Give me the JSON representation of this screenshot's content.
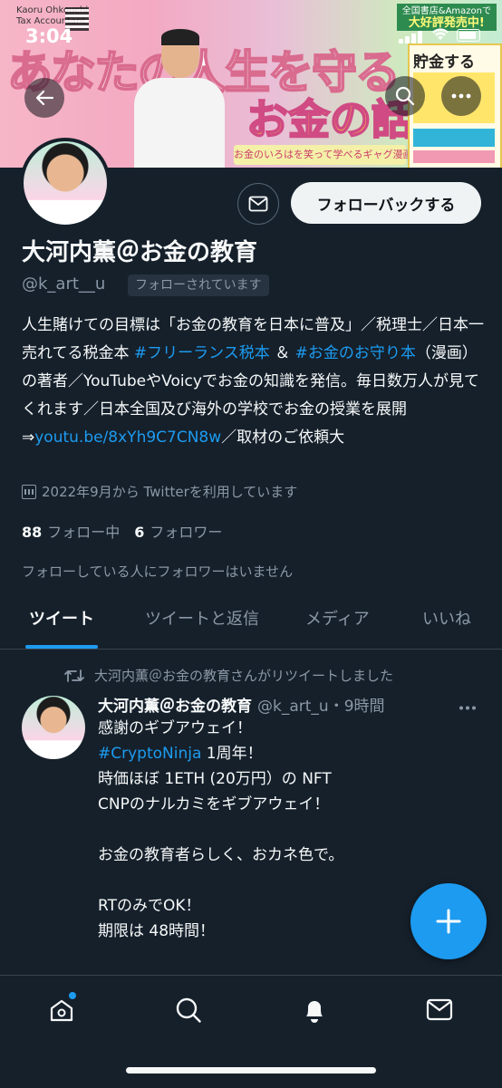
{
  "status": {
    "time": "3:04"
  },
  "banner": {
    "brand_name": "Kaoru Ohkouchi",
    "brand_sub": "Tax Accountant",
    "title_line1": "あなたの人生を守る",
    "title_line2": "お金の話",
    "subtitle": "お金のいろはを笑って学べるギャグ漫画",
    "promo_line1": "全国書店&Amazonで",
    "promo_line2": "大好評発売中!",
    "book_title": "貯金する"
  },
  "profile": {
    "display_name": "大河内薫＠お金の教育",
    "handle": "@k_art__u",
    "follows_you_badge": "フォローされています",
    "follow_back_label": "フォローバックする",
    "bio_part1": "人生賭けての目標は「お金の教育を日本に普及」／税理士／日本一売れてる税金本 ",
    "bio_tag1": "#フリーランス税本",
    "bio_part2": " ＆ ",
    "bio_tag2": "#お金のお守り本",
    "bio_part3": "（漫画）の著者／YouTubeやVoicyでお金の知識を発信。毎日数万人が見てくれます／日本全国及び海外の学校でお金の授業を展開⇒",
    "bio_link": "youtu.be/8xYh9C7CN8w",
    "bio_part4": "／取材のご依頼大",
    "joined": "2022年9月から Twitterを利用しています",
    "following_count": "88",
    "following_label": "フォロー中",
    "followers_count": "6",
    "followers_label": "フォロワー",
    "no_mutual": "フォローしている人にフォロワーはいません"
  },
  "tabs": [
    {
      "label": "ツイート",
      "active": true
    },
    {
      "label": "ツイートと返信"
    },
    {
      "label": "メディア"
    },
    {
      "label": "いいね"
    }
  ],
  "tweet": {
    "retweet_note": "大河内薫＠お金の教育さんがリツイートしました",
    "author_name": "大河内薫＠お金の教育",
    "author_meta": "@k_art_u・9時間",
    "line1": "感謝のギブアウェイ！",
    "hashtag": "#CryptoNinja",
    "line2_rest": " 1周年！",
    "body_rest": "\n時価ほぼ 1ETH (20万円）の NFT\nCNPのナルカミをギブアウェイ！\n\nお金の教育者らしく、おカネ色で。\n\nRTのみでOK！\n期限は 48時間！"
  },
  "colors": {
    "accent": "#1d9bf0",
    "background": "#15202b",
    "muted": "#8b98a5"
  },
  "icons": [
    "back-arrow-icon",
    "search-icon",
    "more-icon",
    "mail-icon",
    "calendar-icon",
    "retweet-icon",
    "plus-icon",
    "home-icon",
    "explore-icon",
    "notifications-icon",
    "messages-icon"
  ]
}
